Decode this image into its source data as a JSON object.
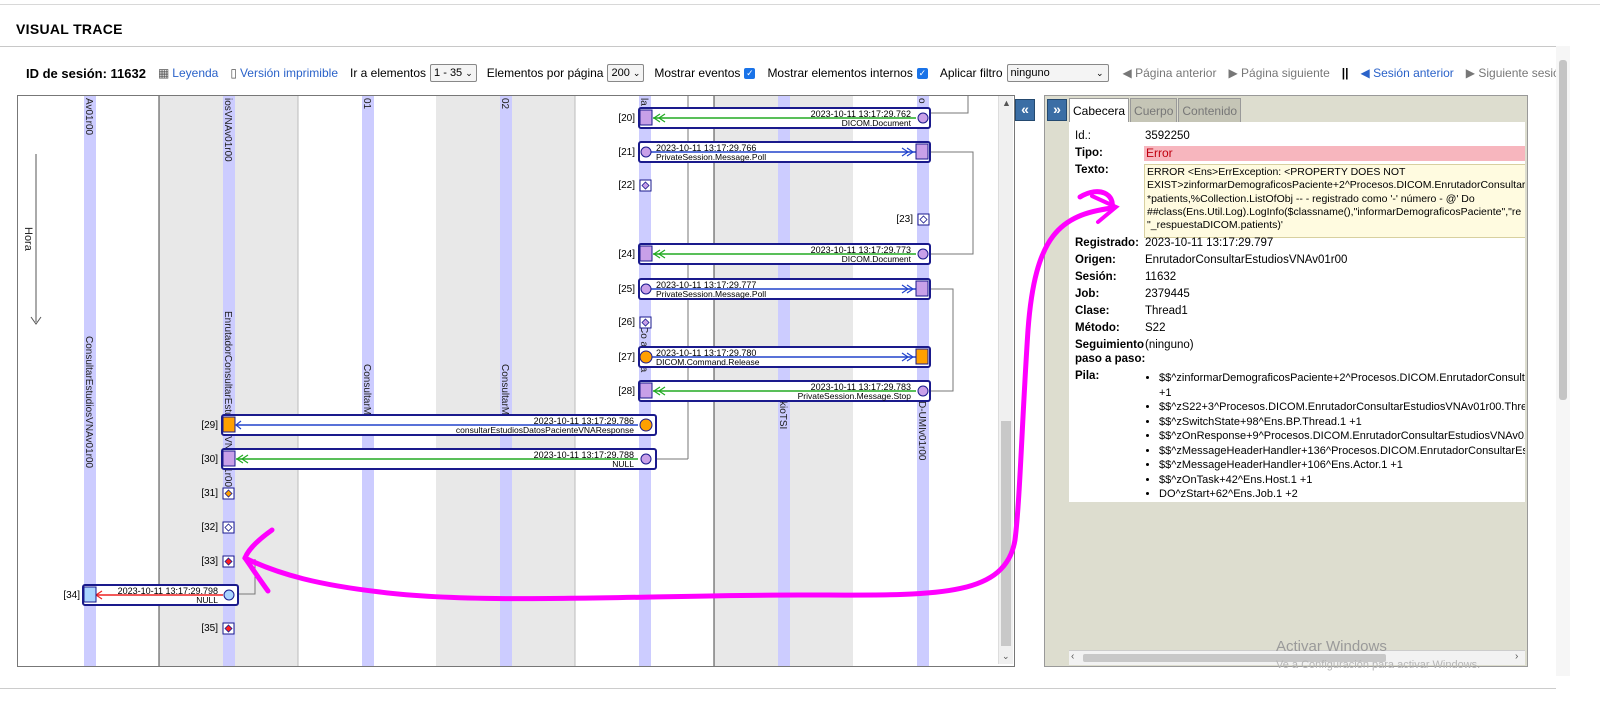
{
  "app": {
    "title": "VISUAL TRACE"
  },
  "toolbar": {
    "session_label": "ID de sesión: 11632",
    "legend": "Leyenda",
    "printable": "Versión imprimible",
    "goto_label": "Ir a elementos",
    "goto_value": "1 - 35",
    "per_page_label": "Elementos por página",
    "per_page_value": "200",
    "show_events": "Mostrar eventos",
    "show_internal": "Mostrar elementos internos",
    "filter_label": "Aplicar filtro",
    "filter_value": "ninguno",
    "prev_page": "Página anterior",
    "next_page": "Página siguiente",
    "separator": "||",
    "prev_session": "Sesión anterior",
    "next_session": "Siguiente sesión"
  },
  "trace": {
    "time_axis": "Hora",
    "columns": [
      {
        "label": "ConsultarEstudiosVNAv01r00",
        "top_label": "Av01r00"
      },
      {
        "label": "EnrutadorConsultarEstudiosVNAv01r00",
        "top_label": "iosVNAv01r00"
      },
      {
        "label": "ConsultarM",
        "top_label": "01"
      },
      {
        "label": "ConsultarM",
        "top_label": "02"
      },
      {
        "label": "Co ar ndia",
        "top_label": "la nd"
      },
      {
        "label": "kioTSI",
        "top_label": ""
      },
      {
        "label": "D-UMIv01r00",
        "top_label": "o"
      }
    ],
    "labels": [
      "[20]",
      "[21]",
      "[22]",
      "[23]",
      "[24]",
      "[25]",
      "[26]",
      "[27]",
      "[28]",
      "[29]",
      "[30]",
      "[31]",
      "[32]",
      "[33]",
      "[34]",
      "[35]"
    ],
    "messages": [
      {
        "id": "20",
        "time": "2023-10-11 13:17:29.762",
        "name": "DICOM.Document"
      },
      {
        "id": "21",
        "time": "2023-10-11 13:17:29.766",
        "name": "PrivateSession.Message.Poll"
      },
      {
        "id": "24",
        "time": "2023-10-11 13:17:29.773",
        "name": "DICOM.Document"
      },
      {
        "id": "25",
        "time": "2023-10-11 13:17:29.777",
        "name": "PrivateSession.Message.Poll"
      },
      {
        "id": "27",
        "time": "2023-10-11 13:17:29.780",
        "name": "DICOM.Command.Release"
      },
      {
        "id": "28",
        "time": "2023-10-11 13:17:29.783",
        "name": "PrivateSession.Message.Stop"
      },
      {
        "id": "29",
        "time": "2023-10-11 13:17:29.786",
        "name": "consultarEstudiosDatosPacienteVNAResponse"
      },
      {
        "id": "30",
        "time": "2023-10-11 13:17:29.788",
        "name": "NULL"
      },
      {
        "id": "34",
        "time": "2023-10-11 13:17:29.798",
        "name": "NULL"
      }
    ]
  },
  "panel": {
    "tabs": [
      "Cabecera",
      "Cuerpo",
      "Contenido"
    ],
    "fields": {
      "id_label": "Id.:",
      "id": "3592250",
      "tipo_label": "Tipo:",
      "tipo": "Error",
      "texto_label": "Texto:",
      "texto_lines": [
        "ERROR <Ens>ErrException: <PROPERTY DOES NOT",
        "EXIST>zinformarDemograficosPaciente+2^Procesos.DICOM.EnrutadorConsultar",
        "*patients,%Collection.ListOfObj -- - registrado como '-' número - @' Do",
        "##class(Ens.Util.Log).LogInfo($classname(),\"informarDemograficosPaciente\",\"re",
        "\"_respuestaDICOM.patients)'"
      ],
      "registrado_label": "Registrado:",
      "registrado": "2023-10-11 13:17:29.797",
      "origen_label": "Origen:",
      "origen": "EnrutadorConsultarEstudiosVNAv01r00",
      "sesion_label": "Sesión:",
      "sesion": "11632",
      "job_label": "Job:",
      "job": "2379445",
      "clase_label": "Clase:",
      "clase": "Thread1",
      "metodo_label": "Método:",
      "metodo": "S22",
      "seguimiento_label_1": "Seguimiento",
      "seguimiento_label_2": "paso a paso:",
      "seguimiento": "(ninguno)",
      "pila_label": "Pila:"
    },
    "stack": [
      "$$^zinformarDemograficosPaciente+2^Procesos.DICOM.EnrutadorConsultarE",
      "+1",
      "$$^zS22+3^Procesos.DICOM.EnrutadorConsultarEstudiosVNAv01r00.Thread1",
      "$$^zSwitchState+98^Ens.BP.Thread.1 +1",
      "$$^zOnResponse+9^Procesos.DICOM.EnrutadorConsultarEstudiosVNAv01r0",
      "$$^zMessageHeaderHandler+136^Procesos.DICOM.EnrutadorConsultarEstud",
      "$$^zMessageHeaderHandler+106^Ens.Actor.1 +1",
      "$$^zOnTask+42^Ens.Host.1 +1",
      "DO^zStart+62^Ens.Job.1 +2"
    ]
  },
  "watermark": {
    "line1": "Activar Windows",
    "line2": "Ve a Configuración para activar Windows."
  },
  "colors": {
    "accent": "#2a62c9",
    "annotation": "#ff00ff",
    "error_bg": "#f7b6be",
    "lane": "#ccccff"
  }
}
